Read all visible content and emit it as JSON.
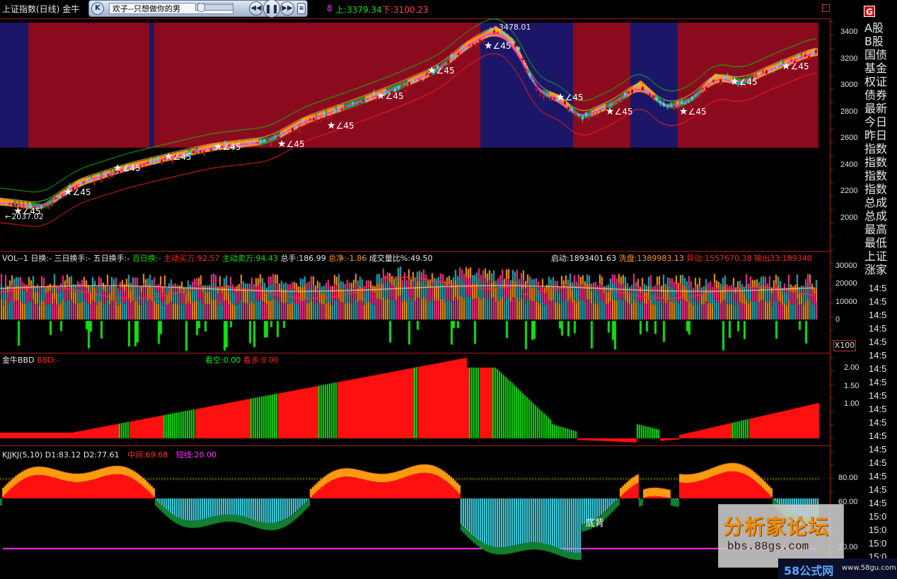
{
  "header": {
    "title": "上证指数(日线)",
    "formula": "金牛",
    "upper_label": "上:3379.34",
    "lower_label": "下:3100.23",
    "num_label": "8",
    "close_icon": "g-icon",
    "g_label": "G"
  },
  "player": {
    "song": "欢子--只想做你的男",
    "play_icon": "pause-icon",
    "prev_icon": "rewind-icon",
    "menu_icon": "menu-icon",
    "volume_icon": "speaker-icon"
  },
  "price_panel": {
    "axis_ticks": [
      "3400",
      "3200",
      "3000",
      "2800",
      "2600",
      "2400",
      "2200",
      "2000"
    ],
    "peak_label": "3478.01",
    "low_label": "←2037.02",
    "angle_labels": [
      "∠45",
      "∠45",
      "∠45",
      "∠45",
      "∠45",
      "∠45",
      "∠45",
      "∠45",
      "∠45",
      "∠45",
      "∠45",
      "∠45",
      "∠45",
      "∠45",
      "∠45"
    ]
  },
  "vol_panel": {
    "name": "VOL--1",
    "day_turnover": "日换:-",
    "three_day": "三日换手:-",
    "five_day": "五日换手:-",
    "hundred_day": "百日换:-",
    "active_buy": "主动买万:92.57",
    "active_sell": "主动卖万:94.43",
    "total_hands": "总手:186.99",
    "net_total": "总净:-1.86",
    "vol_ratio": "成交量比%:49.50",
    "start": "启动:1893401.63",
    "wash": "洗盘:1389983.13",
    "abnormal": "异动:1557670.38",
    "output": "输出33:189340",
    "axis_ticks": [
      "30000",
      "20000",
      "10000",
      "0"
    ],
    "unit": "X100"
  },
  "bbd_panel": {
    "name": "金牛BBD",
    "bbd": "BBD:-",
    "bear": "看空:0.00",
    "bull": "看多:0.00",
    "axis_ticks": [
      "2.00",
      "1.50",
      "1.00"
    ]
  },
  "kj_panel": {
    "name": "KJJKJ(5,10)",
    "d1": "D1:83.12",
    "d2": "D2:77.61",
    "mid": "中间:69.68",
    "short": "短线:20.00",
    "axis_ticks": [
      "80.00",
      "60.00",
      "20.00"
    ],
    "divergence": "底背"
  },
  "right_panel": {
    "items": [
      "A股",
      "B股",
      "国债",
      "基金",
      "权证",
      "债券",
      "最新",
      "今日",
      "昨日",
      "指数",
      "指数",
      "指数",
      "指数",
      "总成",
      "总成",
      "最高",
      "最低",
      "上证",
      "涨家"
    ],
    "times": [
      "14:5",
      "14:5",
      "14:5",
      "14:5",
      "14:5",
      "14:5",
      "14:5",
      "14:5",
      "14:5",
      "14:5",
      "14:5",
      "14:5",
      "14:5",
      "14:5",
      "14:5",
      "14:5",
      "14:5",
      "15:0",
      "15:0",
      "15:0",
      "15:0"
    ]
  },
  "watermark": {
    "cn": "分析家论坛",
    "url": "bbs.88gs.com"
  },
  "logo": {
    "name": "58公式网",
    "url": "www.58gu.com"
  },
  "colors": {
    "background": "#000000",
    "red_band": "#8b0a1e",
    "blue_band": "#1c1668",
    "up_red": "#ff2020",
    "down_cyan": "#40e0f0",
    "green": "#10e010",
    "orange": "#ff9a10",
    "magenta": "#ff30ff",
    "grid_red": "#b02020"
  }
}
